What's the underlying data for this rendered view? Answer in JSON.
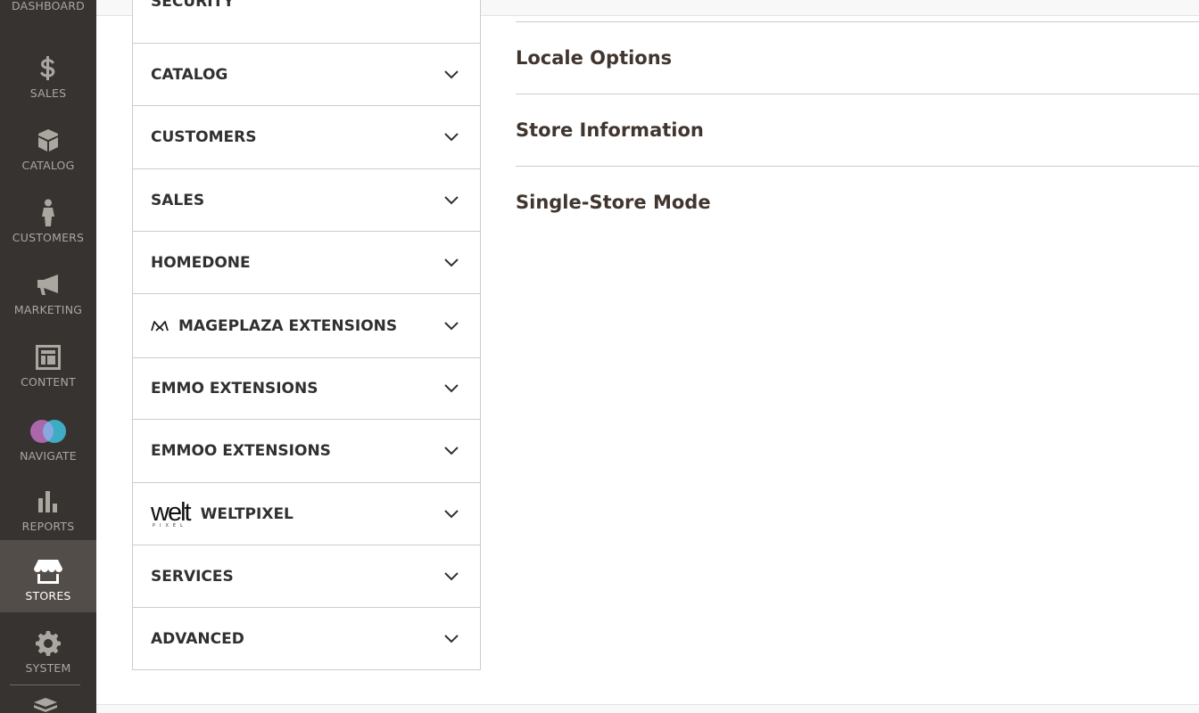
{
  "admin_nav": {
    "items": [
      {
        "label": "DASHBOARD",
        "icon": "dashboard-icon"
      },
      {
        "label": "SALES",
        "icon": "dollar-icon"
      },
      {
        "label": "CATALOG",
        "icon": "box-icon"
      },
      {
        "label": "CUSTOMERS",
        "icon": "person-icon"
      },
      {
        "label": "MARKETING",
        "icon": "megaphone-icon"
      },
      {
        "label": "CONTENT",
        "icon": "layout-icon"
      },
      {
        "label": "NAVIGATE",
        "icon": "navigate-logo-icon"
      },
      {
        "label": "REPORTS",
        "icon": "bar-chart-icon"
      },
      {
        "label": "STORES",
        "icon": "storefront-icon"
      },
      {
        "label": "SYSTEM",
        "icon": "gear-icon"
      }
    ],
    "active": "STORES",
    "colors": {
      "bg": "#373330",
      "active_bg": "#524d49",
      "text": "#aaa6a0"
    }
  },
  "config_tabs": {
    "partial_top_label": "SECURITY",
    "items": [
      {
        "label": "CATALOG"
      },
      {
        "label": "CUSTOMERS"
      },
      {
        "label": "SALES"
      },
      {
        "label": "HOMEDONE"
      },
      {
        "label": "MAGEPLAZA EXTENSIONS",
        "logo": "mageplaza-logo-icon"
      },
      {
        "label": "EMMO EXTENSIONS"
      },
      {
        "label": "EMMOO EXTENSIONS"
      },
      {
        "label": "WELTPIXEL",
        "logo_text": "welt",
        "logo_sub": "PIXEL"
      },
      {
        "label": "SERVICES"
      },
      {
        "label": "ADVANCED"
      }
    ]
  },
  "sections": [
    {
      "title": "Locale Options"
    },
    {
      "title": "Store Information"
    },
    {
      "title": "Single-Store Mode"
    }
  ]
}
